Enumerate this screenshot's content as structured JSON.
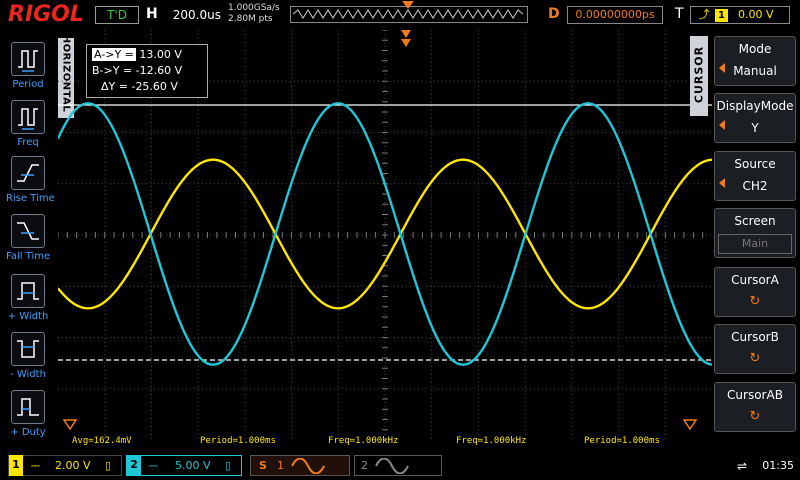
{
  "header": {
    "logo": "RIGOL",
    "run_status": "T'D",
    "horizontal_label": "H",
    "timebase": "200.0us",
    "sample_rate": "1.000GSa/s",
    "memory_depth": "2.80M pts",
    "delay_label": "D",
    "delay_value": "0.00000000ps",
    "trigger_label": "T",
    "trigger_source": "1",
    "trigger_level": "0.00 V"
  },
  "left_menu": {
    "tab_label": "HORIZONTAL",
    "items": [
      {
        "label": "Period",
        "icon": "period-icon"
      },
      {
        "label": "Freq",
        "icon": "frequency-icon"
      },
      {
        "label": "Rise Time",
        "icon": "rise-time-icon"
      },
      {
        "label": "Fall Time",
        "icon": "fall-time-icon"
      },
      {
        "label": "+ Width",
        "icon": "positive-width-icon"
      },
      {
        "label": "- Width",
        "icon": "negative-width-icon"
      },
      {
        "label": "+ Duty",
        "icon": "positive-duty-icon"
      }
    ]
  },
  "cursor_readout": {
    "a_label": "A->Y =",
    "a_value": "13.00 V",
    "b_label": "B->Y =",
    "b_value": "-12.60 V",
    "delta_label": "ΔY =",
    "delta_value": "-25.60 V"
  },
  "measurements": [
    "Avg=162.4mV",
    "Period=1.000ms",
    "Freq=1.000kHz",
    "Freq=1.000kHz",
    "Period=1.000ms"
  ],
  "right_menu": {
    "tab_label": "CURSOR",
    "mode": {
      "title": "Mode",
      "value": "Manual"
    },
    "display_mode": {
      "title": "DisplayMode",
      "value": "Y"
    },
    "source": {
      "title": "Source",
      "value": "CH2"
    },
    "screen": {
      "title": "Screen",
      "value": "Main"
    },
    "cursor_a": {
      "title": "CursorA"
    },
    "cursor_b": {
      "title": "CursorB"
    },
    "cursor_ab": {
      "title": "CursorAB"
    }
  },
  "status_bar": {
    "ch1": {
      "num": "1",
      "coupling": "DC",
      "scale": "2.00 V"
    },
    "ch2": {
      "num": "2",
      "coupling": "DC",
      "scale": "5.00 V"
    },
    "s1": {
      "label": "S",
      "num": "1"
    },
    "s2": {
      "num": "2"
    },
    "usb_icon": "usb-icon",
    "time": "01:35"
  },
  "colors": {
    "ch1": "#ffe600",
    "ch2": "#1ec8d8",
    "accent": "#f07b1a",
    "logo": "#e8251e"
  },
  "waveforms": {
    "ch1": {
      "shape": "sine",
      "frequency_hz": 1000,
      "amplitude_div": 1.45,
      "phase": "inverted"
    },
    "ch2": {
      "shape": "sine",
      "frequency_hz": 1000,
      "amplitude_div": 2.55,
      "phase": "normal"
    }
  }
}
